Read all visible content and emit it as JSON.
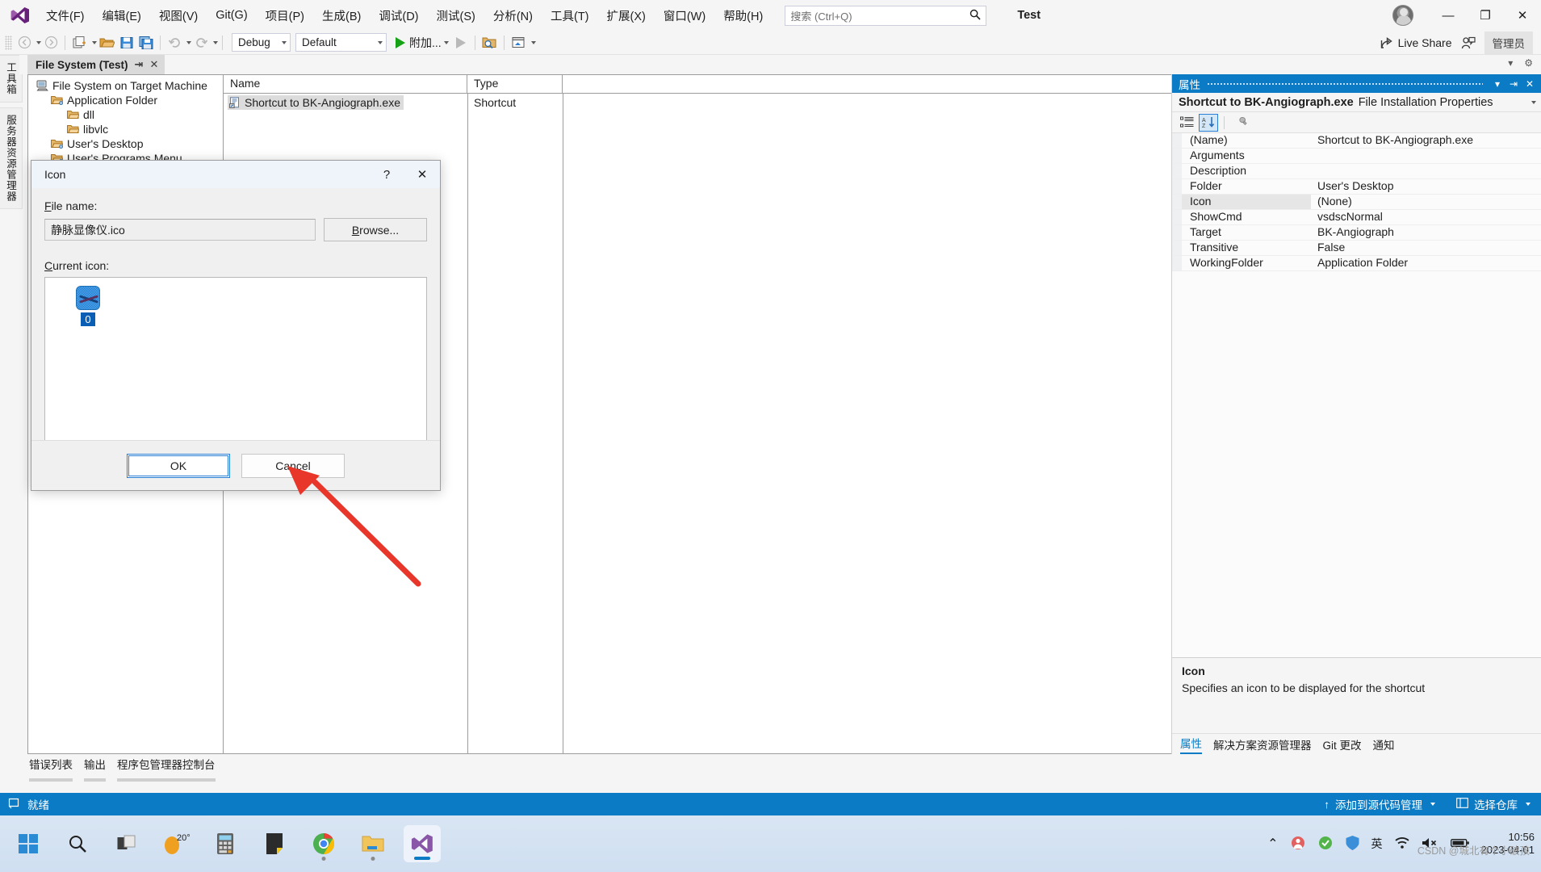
{
  "titlebar": {
    "menus": [
      "文件(F)",
      "编辑(E)",
      "视图(V)",
      "Git(G)",
      "项目(P)",
      "生成(B)",
      "调试(D)",
      "测试(S)",
      "分析(N)",
      "工具(T)",
      "扩展(X)",
      "窗口(W)",
      "帮助(H)"
    ],
    "search_placeholder": "搜索 (Ctrl+Q)",
    "solution_name": "Test",
    "minimize": "—",
    "maximize": "❐",
    "close": "✕"
  },
  "toolbar": {
    "configuration": "Debug",
    "platform": "Default",
    "attach_label": "附加...",
    "live_share": "Live Share",
    "admin_label": "管理员"
  },
  "vtabs": [
    "工具箱",
    "服务器资源管理器"
  ],
  "document": {
    "tab_title": "File System (Test)",
    "pin_icon": "⇥",
    "close_icon": "✕",
    "tree": [
      {
        "label": "File System on Target Machine",
        "indent": 0,
        "icon": "computer-icon"
      },
      {
        "label": "Application Folder",
        "indent": 1,
        "icon": "special-folder-icon"
      },
      {
        "label": "dll",
        "indent": 2,
        "icon": "folder-icon"
      },
      {
        "label": "libvlc",
        "indent": 2,
        "icon": "folder-icon"
      },
      {
        "label": "User's Desktop",
        "indent": 1,
        "icon": "special-folder-icon"
      },
      {
        "label": "User's Programs Menu",
        "indent": 1,
        "icon": "special-folder-icon"
      }
    ],
    "columns": [
      "Name",
      "Type",
      ""
    ],
    "rows": [
      {
        "name": "Shortcut to BK-Angiograph.exe",
        "type": "Shortcut"
      }
    ]
  },
  "bottom_tabs": [
    "错误列表",
    "输出",
    "程序包管理器控制台"
  ],
  "statusbar": {
    "ready": "就绪",
    "source_control": "添加到源代码管理",
    "repo": "选择仓库"
  },
  "properties": {
    "panel_title": "属性",
    "dropdown_icon": "▾",
    "pin_icon": "⇥",
    "close_icon": "✕",
    "object_name": "Shortcut to BK-Angiograph.exe",
    "object_type": "File Installation Properties",
    "rows": [
      {
        "key": "(Name)",
        "value": "Shortcut to BK-Angiograph.exe",
        "selected": false
      },
      {
        "key": "Arguments",
        "value": "",
        "selected": false
      },
      {
        "key": "Description",
        "value": "",
        "selected": false
      },
      {
        "key": "Folder",
        "value": "User's Desktop",
        "selected": false
      },
      {
        "key": "Icon",
        "value": "(None)",
        "selected": true
      },
      {
        "key": "ShowCmd",
        "value": "vsdscNormal",
        "selected": false
      },
      {
        "key": "Target",
        "value": "BK-Angiograph",
        "selected": false
      },
      {
        "key": "Transitive",
        "value": "False",
        "selected": false
      },
      {
        "key": "WorkingFolder",
        "value": "Application Folder",
        "selected": false
      }
    ],
    "desc_title": "Icon",
    "desc_body": "Specifies an icon to be displayed for the shortcut",
    "tabs": [
      "属性",
      "解决方案资源管理器",
      "Git 更改",
      "通知"
    ],
    "active_tab": "属性",
    "accent_color": "#0a7bc4"
  },
  "dialog": {
    "title": "Icon",
    "help_icon": "?",
    "close_icon": "✕",
    "file_name_label": "File name:",
    "file_name_value": "静脉显像仪.ico",
    "browse_label": "Browse...",
    "current_icon_label": "Current icon:",
    "icons": [
      {
        "caption": "0",
        "selected": true
      }
    ],
    "ok_label": "OK",
    "cancel_label": "Cancel"
  },
  "taskbar": {
    "weather_temp": "20°",
    "time": "10:56",
    "date": "2023-04-01",
    "language": "英",
    "chevron": "⌃"
  },
  "watermark": "CSDN @城北有个小破孩"
}
